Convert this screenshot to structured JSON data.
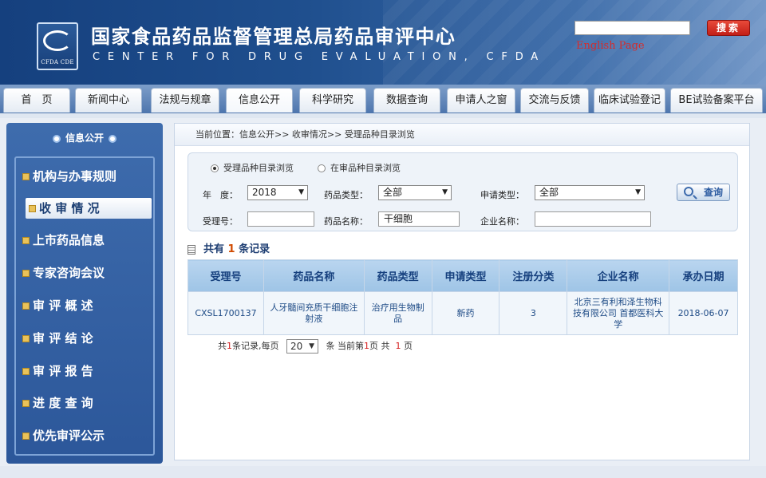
{
  "header": {
    "logo_text": "CFDA CDE",
    "title": "国家食品药品监督管理总局药品审评中心",
    "subtitle": "CENTER  FOR  DRUG  EVALUATION, CFDA",
    "search_value": "",
    "search_button": "搜索",
    "english_link": "English Page"
  },
  "nav": {
    "tabs": [
      {
        "label": "首　页"
      },
      {
        "label": "新闻中心"
      },
      {
        "label": "法规与规章"
      },
      {
        "label": "信息公开",
        "active": true
      },
      {
        "label": "科学研究"
      },
      {
        "label": "数据查询"
      },
      {
        "label": "申请人之窗"
      },
      {
        "label": "交流与反馈"
      },
      {
        "label": "临床试验登记"
      },
      {
        "label": "BE试验备案平台"
      }
    ]
  },
  "sidebar": {
    "title": "信息公开",
    "items": [
      {
        "label": "机构与办事规则"
      },
      {
        "label": "收 审 情 况",
        "active": true
      },
      {
        "label": "上市药品信息"
      },
      {
        "label": "专家咨询会议"
      },
      {
        "label": "审 评 概 述"
      },
      {
        "label": "审 评 结 论"
      },
      {
        "label": "审 评 报 告"
      },
      {
        "label": "进 度 查 询"
      },
      {
        "label": "优先审评公示"
      }
    ]
  },
  "breadcrumb": "当前位置：信息公开>> 收审情况>> 受理品种目录浏览",
  "filter": {
    "radio_1": "受理品种目录浏览",
    "radio_2": "在审品种目录浏览",
    "selected_radio": "受理品种目录浏览",
    "year_label": "年　度：",
    "year_value": "2018",
    "drug_type_label": "药品类型：",
    "drug_type_value": "全部",
    "apply_type_label": "申请类型：",
    "apply_type_value": "全部",
    "accept_no_label": "受理号：",
    "accept_no_value": "",
    "drug_name_label": "药品名称：",
    "drug_name_value": "干细胞",
    "company_label": "企业名称：",
    "company_value": "",
    "query_button": "查询"
  },
  "results": {
    "count_prefix": "共有",
    "count": "1",
    "count_suffix": "条记录",
    "columns": [
      "受理号",
      "药品名称",
      "药品类型",
      "申请类型",
      "注册分类",
      "企业名称",
      "承办日期"
    ],
    "rows": [
      [
        "CXSL1700137",
        "人牙髓间充质干细胞注射液",
        "治疗用生物制品",
        "新药",
        "3",
        "北京三有利和泽生物科技有限公司 首都医科大学",
        "2018-06-07"
      ]
    ]
  },
  "pager": {
    "p1": "共",
    "total": "1",
    "p2": "条记录,每页",
    "per_page": "20",
    "p3": "条 当前第",
    "current": "1",
    "p4": "页 共",
    "pages": "1",
    "p5": "页"
  },
  "colors": {
    "header_blue": "#1f4f8e",
    "sidebar_blue": "#3e6cad",
    "table_header": "#a9cbea",
    "accent_red": "#d41b1b"
  }
}
